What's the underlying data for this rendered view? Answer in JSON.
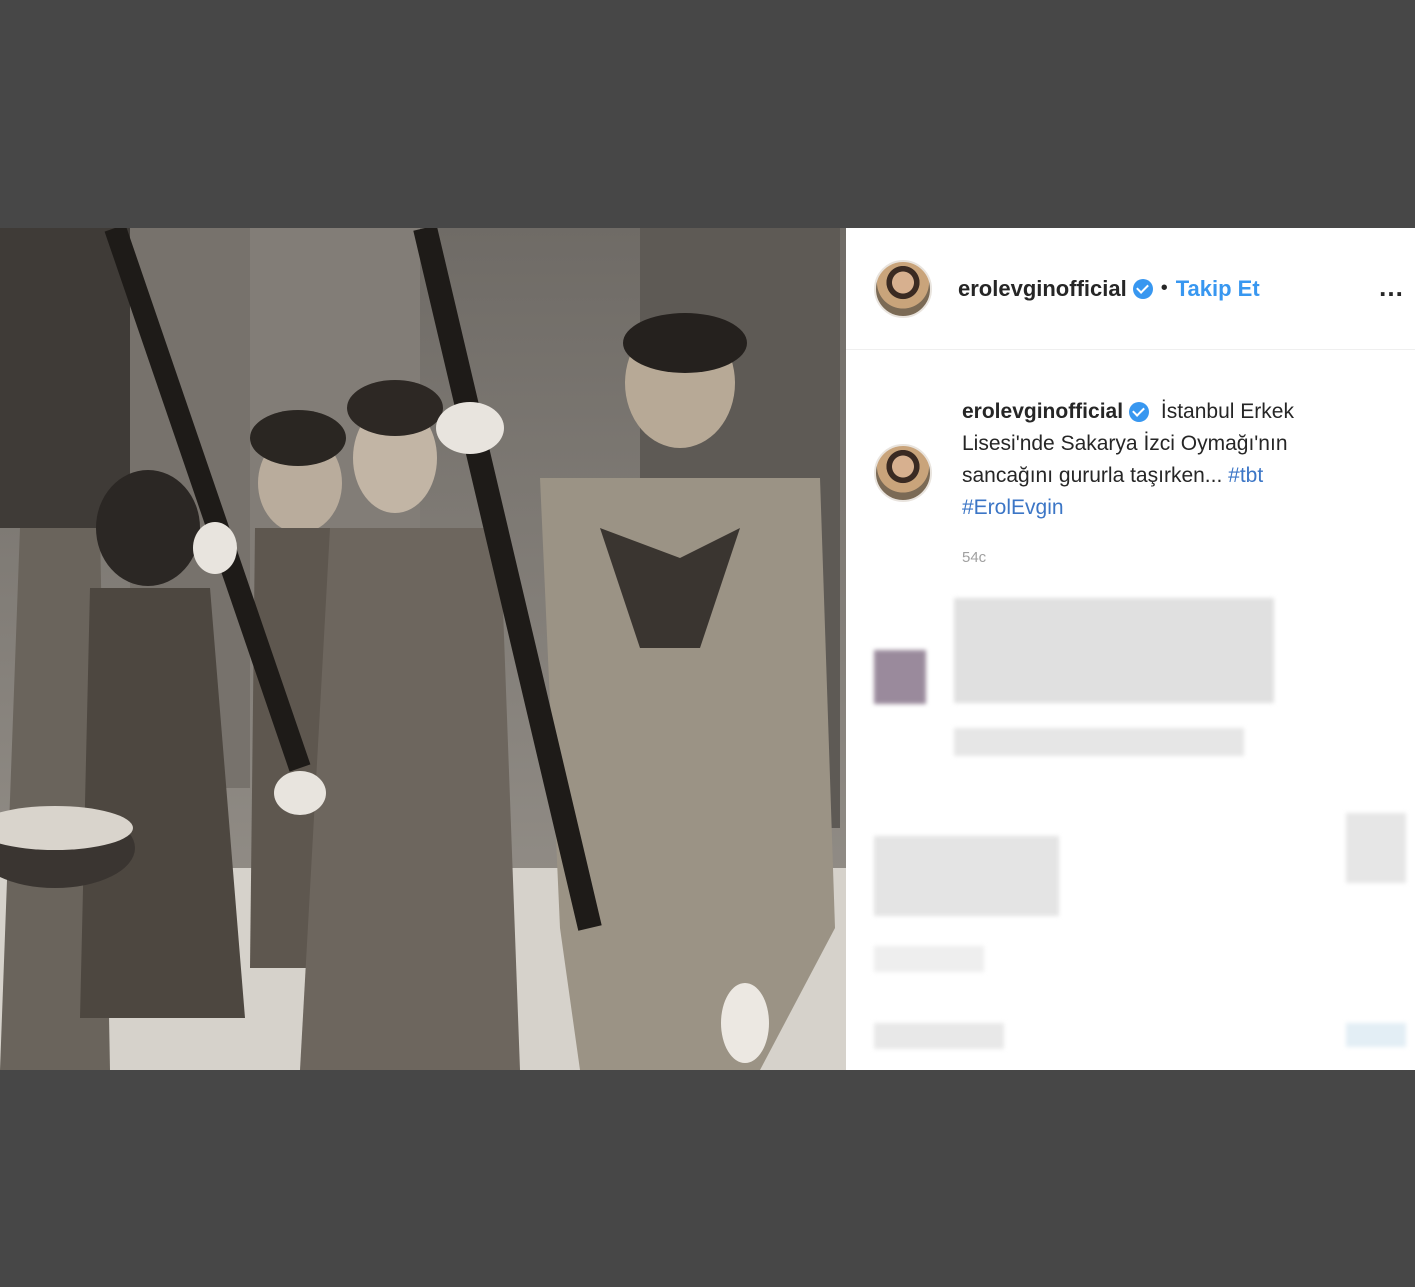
{
  "post": {
    "header": {
      "username": "erolevginofficial",
      "separator": "•",
      "follow_label": "Takip Et",
      "more_icon": "…"
    },
    "caption": {
      "username": "erolevginofficial",
      "text": "İstanbul Erkek Lisesi'nde Sakarya İzci Oymağı'nın sancağını gururla taşırken...",
      "hashtag_1": "#tbt",
      "hashtag_2": "#ErolEvgin",
      "time": "54c"
    },
    "photo": {
      "description_icon": "black-and-white-photo"
    }
  },
  "colors": {
    "background": "#474747",
    "panel": "#ffffff",
    "link": "#3897f0",
    "verified": "#3897f0"
  }
}
